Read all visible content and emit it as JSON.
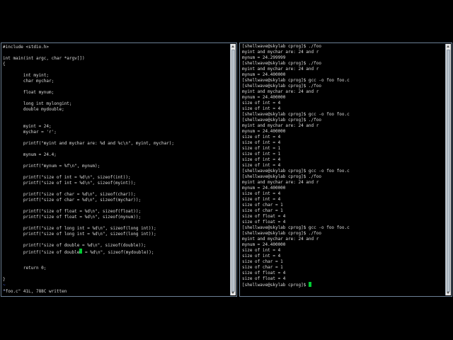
{
  "editor": {
    "lines": [
      "#include <stdio.h>",
      "",
      "int main(int argc, char *argv[])",
      "{",
      "",
      "        int myint;",
      "        char mychar;",
      "",
      "        float mynum;",
      "",
      "        long int mylongint;",
      "        double mydouble;",
      "",
      "",
      "        myint = 24;",
      "        mychar = 'r';",
      "",
      "        printf(\"myint and mychar are: %d and %c\\n\", myint, mychar);",
      "",
      "        mynum = 24.4;",
      "",
      "        printf(\"mynum = %f\\n\", mynum);",
      "",
      "        printf(\"size of int = %d\\n\", sizeof(int));",
      "        printf(\"size of int = %d\\n\", sizeof(myint));",
      "",
      "        printf(\"size of char = %d\\n\", sizeof(char));",
      "        printf(\"size of char = %d\\n\", sizeof(mychar));",
      "",
      "        printf(\"size of float = %d\\n\", sizeof(float));",
      "        printf(\"size of float = %d\\n\", sizeof(mynum));",
      "",
      "        printf(\"size of long int = %d\\n\", sizeof(long int));",
      "        printf(\"size of long int = %d\\n\", sizeof(long int));",
      "",
      "        printf(\"size of double = %d\\n\", sizeof(double));",
      "        printf(\"size of double",
      "",
      "",
      "        return 0;",
      "",
      "}"
    ],
    "line36_after_cursor": " = %d\\n\", sizeof(mydouble));",
    "tildes": [
      "~",
      "~"
    ],
    "status": "\"foo.c\" 41L, 788C written"
  },
  "terminal": {
    "lines": [
      "[shellwave@skylab cprog]$ ./foo",
      "myint and mychar are: 24 and r",
      "mynum = 24.299999",
      "[shellwave@skylab cprog]$ ./foo",
      "myint and mychar are: 24 and r",
      "mynum = 24.400000",
      "[shellwave@skylab cprog]$ gcc -o foo foo.c",
      "[shellwave@skylab cprog]$ ./foo",
      "myint and mychar are: 24 and r",
      "mynum = 24.400000",
      "size of int = 4",
      "size of int = 4",
      "[shellwave@skylab cprog]$ gcc -o foo foo.c",
      "[shellwave@skylab cprog]$ ./foo",
      "myint and mychar are: 24 and r",
      "mynum = 24.400000",
      "size of int = 4",
      "size of int = 4",
      "size of int = 1",
      "size of int = 1",
      "size of int = 4",
      "size of int = 4",
      "[shellwave@skylab cprog]$ gcc -o foo foo.c",
      "[shellwave@skylab cprog]$ ./foo",
      "myint and mychar are: 24 and r",
      "mynum = 24.400000",
      "size of int = 4",
      "size of int = 4",
      "size of char = 1",
      "size of char = 1",
      "size of float = 4",
      "size of float = 4",
      "[shellwave@skylab cprog]$ gcc -o foo foo.c",
      "[shellwave@skylab cprog]$ ./foo",
      "myint and mychar are: 24 and r",
      "mynum = 24.400000",
      "size of int = 4",
      "size of int = 4",
      "size of char = 1",
      "size of char = 1",
      "size of float = 4",
      "size of float = 4"
    ],
    "prompt": "[shellwave@skylab cprog]$ "
  }
}
